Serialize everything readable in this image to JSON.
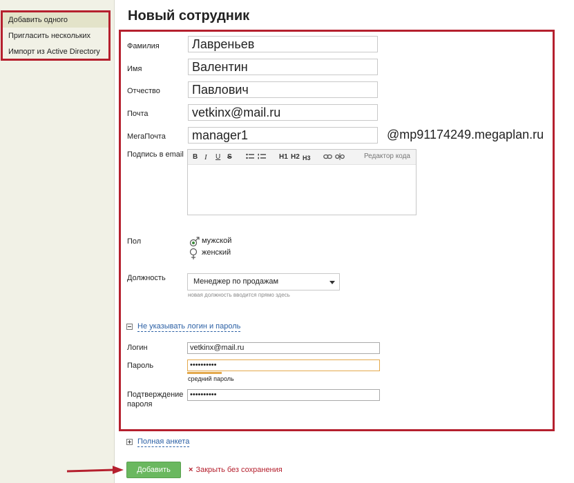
{
  "sidebar": {
    "items": [
      {
        "label": "Добавить одного",
        "active": true
      },
      {
        "label": "Пригласить нескольких"
      },
      {
        "label": "Импорт из Active Directory"
      }
    ]
  },
  "form": {
    "title": "Новый сотрудник",
    "fields": {
      "last_name": {
        "label": "Фамилия",
        "value": "Лавреньев"
      },
      "first_name": {
        "label": "Имя",
        "value": "Валентин"
      },
      "patronymic": {
        "label": "Отчество",
        "value": "Павлович"
      },
      "email": {
        "label": "Почта",
        "value": "vetkinx@mail.ru"
      },
      "megapochta": {
        "label": "МегаПочта",
        "value": "manager1",
        "domain": "@mp91174249.megaplan.ru"
      },
      "signature": {
        "label": "Подпись в email",
        "value": ""
      }
    },
    "editor_toolbar": {
      "bold": "B",
      "italic": "I",
      "underline": "U",
      "strike": "S",
      "h1": "H1",
      "h2": "H2",
      "h3": "H3",
      "code_editor": "Редактор кода"
    },
    "gender": {
      "label": "Пол",
      "options": [
        "мужской",
        "женский"
      ],
      "selected": "мужской"
    },
    "position": {
      "label": "Должность",
      "value": "Менеджер по продажам",
      "hint": "новая должность вводится прямо здесь"
    },
    "login_toggle": "Не указывать логин и пароль",
    "login": {
      "label": "Логин",
      "value": "vetkinx@mail.ru"
    },
    "password": {
      "label": "Пароль",
      "value": "••••••••••",
      "strength_label": "средний пароль",
      "strength": 0.5
    },
    "password_confirm": {
      "label_line1": "Подтверждение",
      "label_line2": "пароля",
      "value": "••••••••••"
    },
    "full_profile_toggle": "Полная анкета"
  },
  "actions": {
    "add_label": "Добавить",
    "close_label": "Закрыть без сохранения",
    "close_icon": "×"
  },
  "colors": {
    "highlight_border": "#b5202e",
    "add_button": "#6ab85f",
    "link": "#2a5fa4",
    "sidebar_bg": "#f1f1e6"
  }
}
